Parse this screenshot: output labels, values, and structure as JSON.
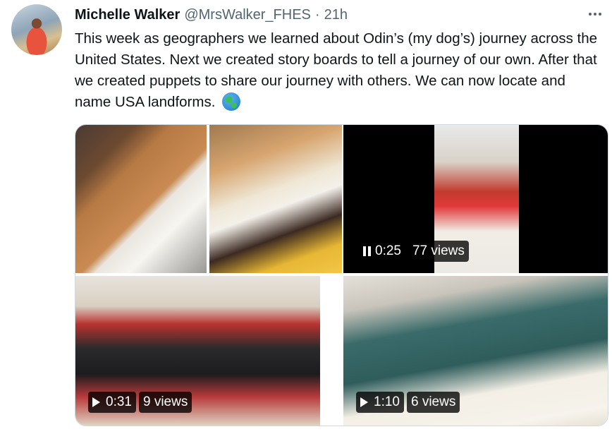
{
  "tweet": {
    "author_name": "Michelle Walker",
    "handle": "@MrsWalker_FHES",
    "separator": "·",
    "time": "21h",
    "text": "This week as geographers we learned about Odin’s (my dog’s) journey across the United States. Next we created story boards to tell a journey of our own. After that we created puppets to share our journey with others. We can now locate and name USA landforms.",
    "text_emoji": "globe-emoji"
  },
  "media": {
    "videos": [
      {
        "state": "pause",
        "duration": "0:25",
        "views": "77 views"
      },
      {
        "state": "play",
        "duration": "0:31",
        "views": "9 views"
      },
      {
        "state": "play",
        "duration": "1:10",
        "views": "6 views"
      }
    ]
  },
  "icons": {
    "more": "more-horizontal-icon",
    "pause": "pause-icon",
    "play": "play-icon"
  },
  "colors": {
    "text": "#0f1419",
    "secondary": "#536471",
    "border": "#cfd9de",
    "badge_bg": "#000000c7"
  }
}
